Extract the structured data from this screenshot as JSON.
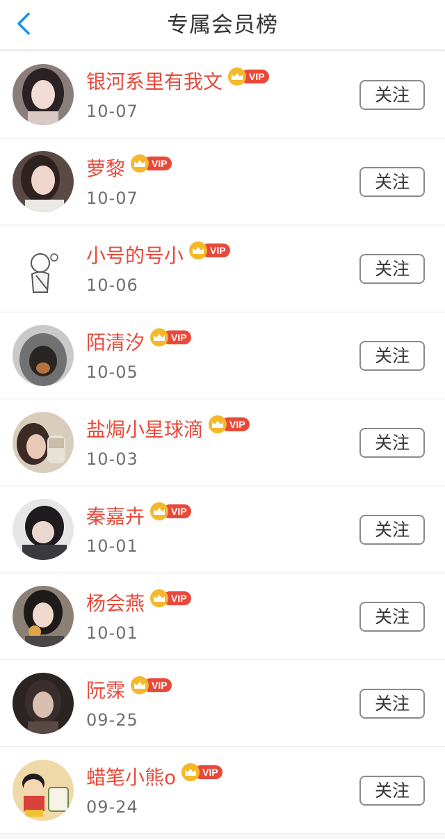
{
  "header": {
    "title": "专属会员榜",
    "back_icon": "chevron-left-icon",
    "accent_color": "#1f8ee8"
  },
  "vip_badge": {
    "icon": "crown-icon",
    "label": "VIP",
    "colors": {
      "crown": "#f5b82a",
      "badge": "#e8493a"
    }
  },
  "colors": {
    "name": "#e8493a",
    "date": "#6f6f6f",
    "button_border": "#8a8a8a"
  },
  "members": [
    {
      "name": "银河系里有我文",
      "date": "10-07",
      "follow_label": "关注",
      "avatar_tone": "#3a3033"
    },
    {
      "name": "萝黎",
      "date": "10-07",
      "follow_label": "关注",
      "avatar_tone": "#4a3a36"
    },
    {
      "name": "小号的号小",
      "date": "10-06",
      "follow_label": "关注",
      "avatar_tone": "#ffffff"
    },
    {
      "name": "陌清汐",
      "date": "10-05",
      "follow_label": "关注",
      "avatar_tone": "#6d6f70"
    },
    {
      "name": "盐焗小星球滴",
      "date": "10-03",
      "follow_label": "关注",
      "avatar_tone": "#b5a58e"
    },
    {
      "name": "秦嘉卉",
      "date": "10-01",
      "follow_label": "关注",
      "avatar_tone": "#3b3b3f"
    },
    {
      "name": "杨会燕",
      "date": "10-01",
      "follow_label": "关注",
      "avatar_tone": "#55504c"
    },
    {
      "name": "阮霂",
      "date": "09-25",
      "follow_label": "关注",
      "avatar_tone": "#3d3533"
    },
    {
      "name": "蜡笔小熊o",
      "date": "09-24",
      "follow_label": "关注",
      "avatar_tone": "#f0d9a8"
    }
  ]
}
